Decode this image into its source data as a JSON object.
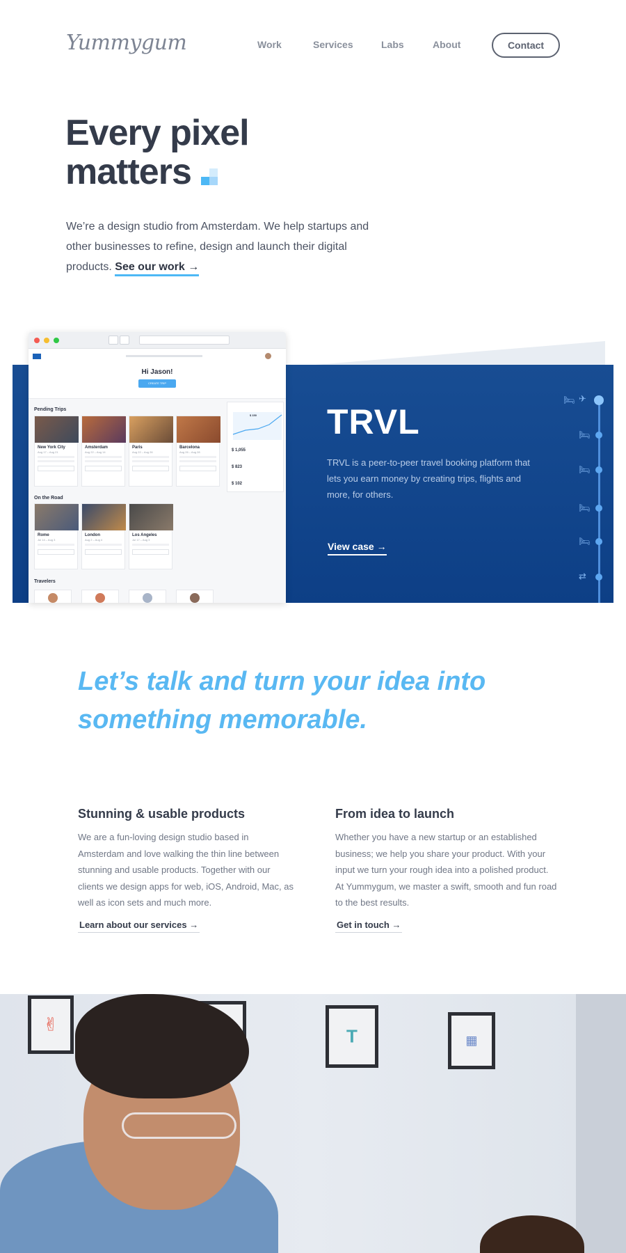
{
  "nav": {
    "logo": "Yummygum",
    "links": [
      "Work",
      "Services",
      "Labs",
      "About"
    ],
    "contact": "Contact"
  },
  "hero": {
    "title_line1": "Every pixel",
    "title_line2": "matters",
    "text": "We’re a design studio from Amsterdam. We help startups and other businesses to refine, design and launch their digital products.",
    "link": "See our work →"
  },
  "case": {
    "title": "TRVL",
    "description": "TRVL is a peer-to-peer travel booking platform that lets you earn money by creating trips, flights and more, for others.",
    "link": "View case →",
    "mockup": {
      "greeting": "Hi Jason!",
      "cta": "CREATE TRIP",
      "pending_heading": "Pending Trips",
      "road_heading": "On the Road",
      "travelers_heading": "Travelers",
      "pending": [
        {
          "city": "New York City",
          "dates": "Aug 17 – Aug 21"
        },
        {
          "city": "Amsterdam",
          "dates": "Aug 22 – Aug 14"
        },
        {
          "city": "Paris",
          "dates": "Aug 22 – Aug 26"
        },
        {
          "city": "Barcelona",
          "dates": "Aug 26 – Aug 28"
        }
      ],
      "road": [
        {
          "city": "Rome",
          "dates": "Jul 14 – Aug 3"
        },
        {
          "city": "London",
          "dates": "Aug 2 – Aug 4"
        },
        {
          "city": "Los Angeles",
          "dates": "Jul 17 – Aug 3"
        }
      ],
      "stats": [
        {
          "label": "PENDING",
          "value": "$ 1,055"
        },
        {
          "label": "COMPLETED",
          "value": "$ 823"
        },
        {
          "label": "PAID",
          "value": "$ 102"
        }
      ],
      "chart_label": "$ 150"
    }
  },
  "talk": {
    "line1": "Let’s talk and turn your idea into",
    "line2": "something memorable."
  },
  "columns": [
    {
      "heading": "Stunning & usable products",
      "text": "We are a fun-loving design studio based in Amsterdam and love walking the thin line between stunning and usable products. Together with our clients we design apps for web, iOS, Android, Mac, as well as icon sets and much more.",
      "link": "Learn about our services →"
    },
    {
      "heading": "From idea to launch",
      "text": "Whether you have a new startup or an established business; we help you share your product. With your input we turn your rough idea into a polished product. At Yummygum, we master a swift, smooth and fun road to the best results.",
      "link": "Get in touch →"
    }
  ],
  "colors": {
    "accent": "#4db8f5",
    "headline": "#59b8f2",
    "trvl_blue": "#0d3f86",
    "text_dark": "#343b4a"
  }
}
